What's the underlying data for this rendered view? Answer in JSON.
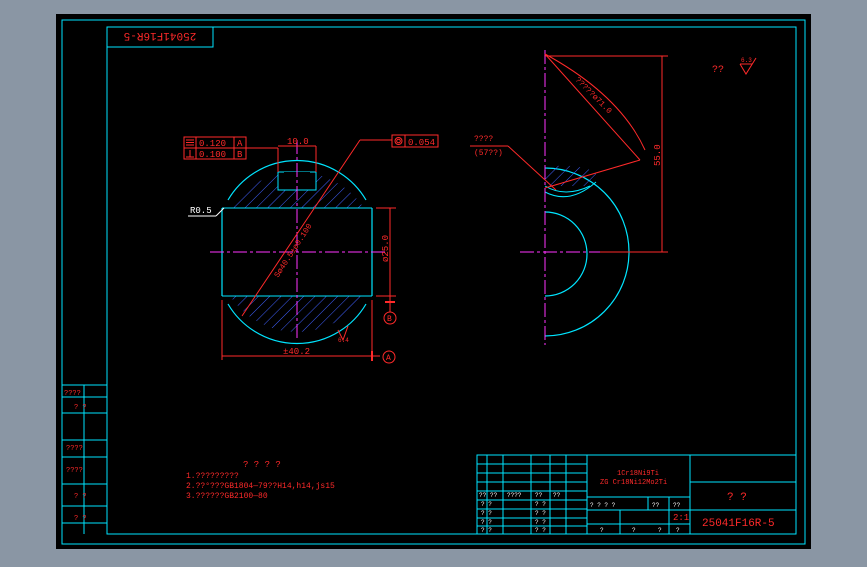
{
  "colors": {
    "frame_bg": "#8a96a4",
    "paper": "#000000",
    "cyan": "#00e5ff",
    "red": "#ff2a2a",
    "magenta": "#ff33ff",
    "blue": "#4060ff",
    "white": "#ffffff"
  },
  "title_tab": "25041F16R-5",
  "front_view": {
    "roundness": "0.120",
    "roundness_ref": "A",
    "perpendicularity": "0.100",
    "perpendicularity_ref": "B",
    "slot_width": "10.0",
    "concentricity": "0.054",
    "fillet": "R0.5",
    "sphere_dia": "Sø40.5±ø0.100",
    "height": "ø25.0",
    "width": "±40.2",
    "datum_a": "A",
    "datum_b": "B",
    "roughness_small": "6.4"
  },
  "side_view": {
    "label_1": "????",
    "label_2": "(57??)",
    "radius_label": "?????ø71.0",
    "height": "55.0"
  },
  "roughness_note": {
    "label": "??",
    "value": "6.3"
  },
  "notes": {
    "heading": "? ? ? ?",
    "lines": [
      "1.?????????",
      "2.??°???GB1804—79??H14,h14,js15",
      "3.??????GB2100—80"
    ]
  },
  "left_strip": {
    "rows": [
      "????",
      "?  ?",
      "????",
      "????",
      "?  ?",
      "?  ?"
    ]
  },
  "title_block": {
    "material_1": "1Cr18Ni9Ti",
    "material_2": "ZG Cr18Ni12Mo2Ti",
    "name": "?  ?",
    "drawing_no": "25041F16R-5",
    "scale": "2:1",
    "header_cells": [
      "??",
      "??",
      "????",
      "??",
      "??"
    ],
    "left_cells": [
      "? ?",
      "? ?",
      "? ?",
      "? ?",
      "? ?",
      "? ?"
    ],
    "mid_cells": [
      "? ?",
      "? ?",
      "? ?",
      "? ?",
      "? ?",
      "? ?"
    ],
    "info_row": [
      "? ? ? ?",
      "??",
      "??"
    ],
    "bottom_row": [
      "?",
      "?",
      "?",
      "?"
    ]
  }
}
